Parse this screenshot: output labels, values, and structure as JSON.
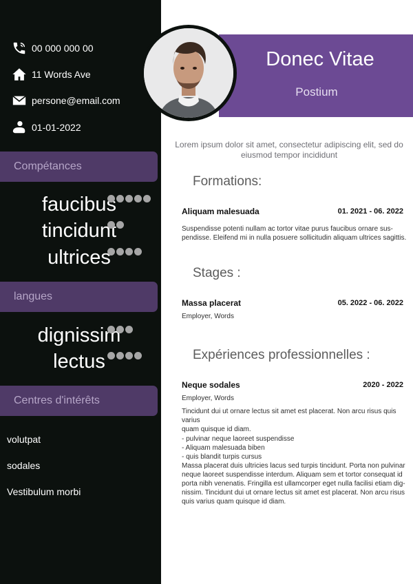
{
  "contact": {
    "phone": "00 000 000 00",
    "address": "11 Words Ave",
    "email": "persone@email.com",
    "birthdate": "01-01-2022"
  },
  "sidebar": {
    "skills_title": "Compétances",
    "skills": [
      {
        "name": "faucibus",
        "level": 5
      },
      {
        "name": "tincidunt",
        "level": 2
      },
      {
        "name": "ultrices",
        "level": 4
      }
    ],
    "languages_title": "langues",
    "languages": [
      {
        "name": "dignissim",
        "level": 3
      },
      {
        "name": "lectus",
        "level": 4
      }
    ],
    "interests_title": "Centres d'intérêts",
    "interests": [
      "volutpat",
      "sodales",
      "Vestibulum morbi"
    ]
  },
  "header": {
    "name": "Donec Vitae",
    "role": "Postium"
  },
  "summary": "Lorem ipsum dolor sit amet, consectetur adipiscing elit, sed do eiusmod tempor incididunt",
  "formations": {
    "title": "Formations:",
    "entry_title": "Aliquam malesuada",
    "entry_date": "01. 2021 - 06. 2022",
    "text": "Suspendisse potenti nullam ac tortor vitae purus faucibus ornare sus-\npendisse. Eleifend mi in nulla posuere sollicitudin aliquam ultrices sagittis."
  },
  "stages": {
    "title": "Stages :",
    "entry_title": "Massa placerat",
    "entry_date": "05. 2022 - 06. 2022",
    "employer": "Employer, Words"
  },
  "experiences": {
    "title": "Expériences professionnelles :",
    "entry_title": "Neque sodales",
    "entry_date": "2020 - 2022",
    "employer": "Employer, Words",
    "text1": "Tincidunt dui ut ornare lectus sit amet est placerat. Non arcu risus quis varius\nquam quisque id diam.",
    "text2": "- pulvinar neque laoreet suspendisse\n- Aliquam malesuada biben\n- quis blandit turpis cursus\nMassa placerat duis ultricies lacus sed turpis tincidunt. Porta non pulvinar\nneque laoreet suspendisse interdum. Aliquam sem et tortor consequat id\nporta nibh venenatis. Fringilla est ullamcorper eget nulla facilisi etiam dig-\nnissim. Tincidunt dui ut ornare lectus sit amet est placerat. Non arcu risus\nquis varius quam quisque id diam."
  },
  "icons": {
    "phone": "phone-icon",
    "address": "home-icon",
    "email": "mail-icon",
    "birthdate": "baby-icon"
  },
  "colors": {
    "sidebar_bg": "#0c110e",
    "accent_purple": "#6c4a94",
    "section_head_bg": "#4f3a67",
    "section_head_text": "#b6a6c8",
    "dot": "#a6a6a6"
  }
}
